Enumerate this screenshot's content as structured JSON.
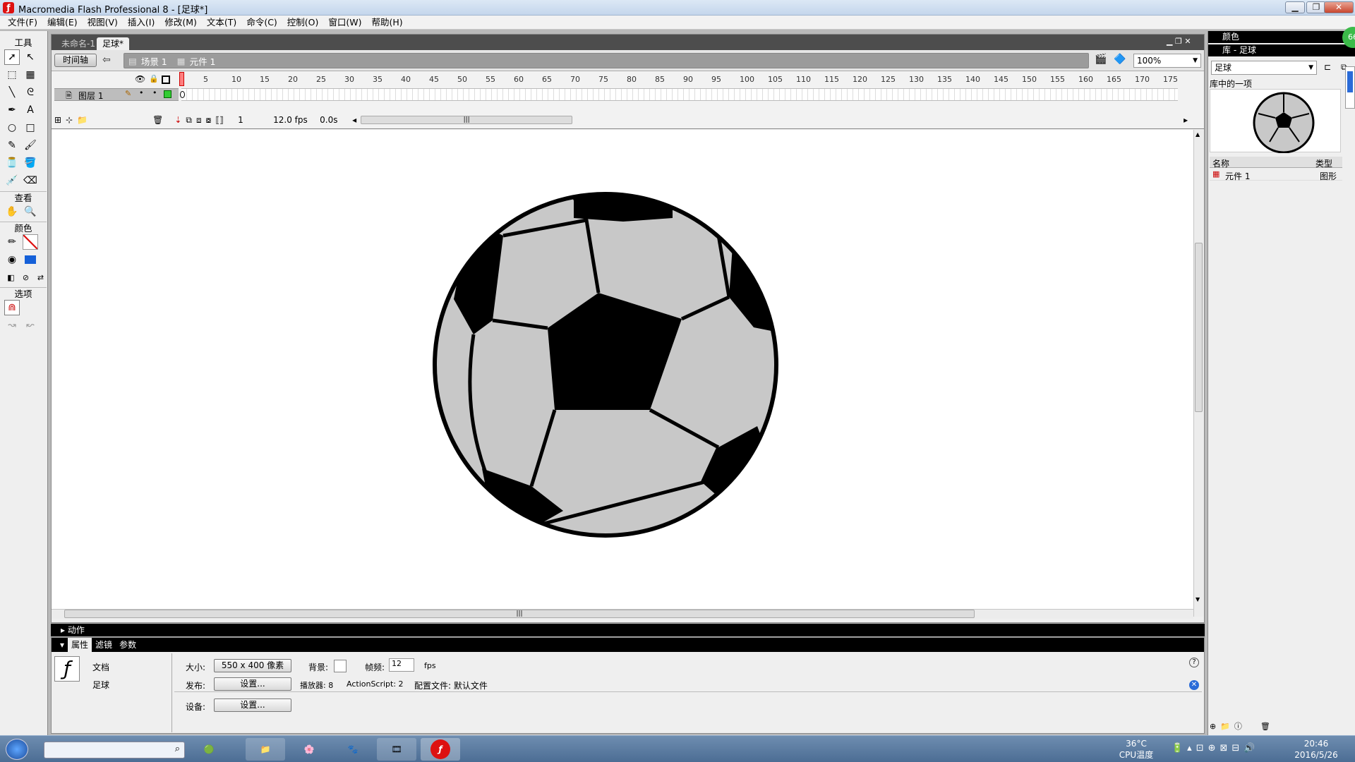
{
  "window": {
    "title": "Macromedia Flash Professional 8 - [足球*]",
    "minimize": "▁",
    "maximize": "❐",
    "close": "✕"
  },
  "menu": [
    "文件(F)",
    "编辑(E)",
    "视图(V)",
    "插入(I)",
    "修改(M)",
    "文本(T)",
    "命令(C)",
    "控制(O)",
    "窗口(W)",
    "帮助(H)"
  ],
  "tools": {
    "title": "工具",
    "view_label": "查看",
    "colors_label": "颜色",
    "options_label": "选项",
    "icons": [
      "selection-tool-icon",
      "subselection-tool-icon",
      "free-transform-icon",
      "fill-transform-icon",
      "line-tool-icon",
      "lasso-tool-icon",
      "pen-tool-icon",
      "text-tool-icon",
      "oval-tool-icon",
      "rectangle-tool-icon",
      "pencil-tool-icon",
      "brush-tool-icon",
      "ink-bottle-icon",
      "paint-bucket-icon",
      "eyedropper-icon",
      "eraser-icon"
    ],
    "glyphs": [
      "➚",
      "↖",
      "⬚",
      "▦",
      "╲",
      "ᘓ",
      "✒",
      "A",
      "○",
      "□",
      "✎",
      "🖌",
      "🫙",
      "🪣",
      "💉",
      "⌫"
    ]
  },
  "doc": {
    "tabs": [
      "未命名-1",
      "足球*"
    ],
    "active_tab": 1,
    "timeline_btn": "时间轴",
    "scene": "场景 1",
    "symbol": "元件 1",
    "zoom": "100%"
  },
  "timeline": {
    "ruler": [
      "5",
      "10",
      "15",
      "20",
      "25",
      "30",
      "35",
      "40",
      "45",
      "50",
      "55",
      "60",
      "65",
      "70",
      "75",
      "80",
      "85",
      "90",
      "95",
      "100",
      "105",
      "110",
      "115",
      "120",
      "125",
      "130",
      "135",
      "140",
      "145",
      "150",
      "155",
      "160",
      "165",
      "170",
      "175"
    ],
    "layer_name": "图层 1",
    "current_frame": "1",
    "fps": "12.0 fps",
    "time": "0.0s"
  },
  "panels": {
    "actions": "动作",
    "props_tabs": [
      "属性",
      "滤镜",
      "参数"
    ]
  },
  "props": {
    "doc_type": "文档",
    "doc_name": "足球",
    "size_label": "大小:",
    "size_value": "550 x 400 像素",
    "bg_label": "背景:",
    "framerate_label": "帧频:",
    "framerate_value": "12",
    "fps_unit": "fps",
    "publish_label": "发布:",
    "settings_btn": "设置...",
    "player_label": "播放器: 8",
    "actionscript_label": "ActionScript: 2",
    "profile_label": "配置文件: 默认文件",
    "device_label": "设备:",
    "device_btn": "设置..."
  },
  "right": {
    "colors_title": "颜色",
    "library_title": "库 - 足球",
    "library_select": "足球",
    "library_info": "库中的一项",
    "col_name": "名称",
    "col_type": "类型",
    "items": [
      {
        "name": "元件 1",
        "type": "图形"
      }
    ],
    "badge": "66"
  },
  "taskbar": {
    "cpu_temp": "36°C",
    "cpu_label": "CPU温度",
    "time": "20:46",
    "date": "2016/5/26"
  },
  "colors": {
    "accent": "#d11f1f",
    "stage": "#ffffff",
    "ball_fill": "#c8c8c8",
    "ball_stroke": "#000000"
  }
}
